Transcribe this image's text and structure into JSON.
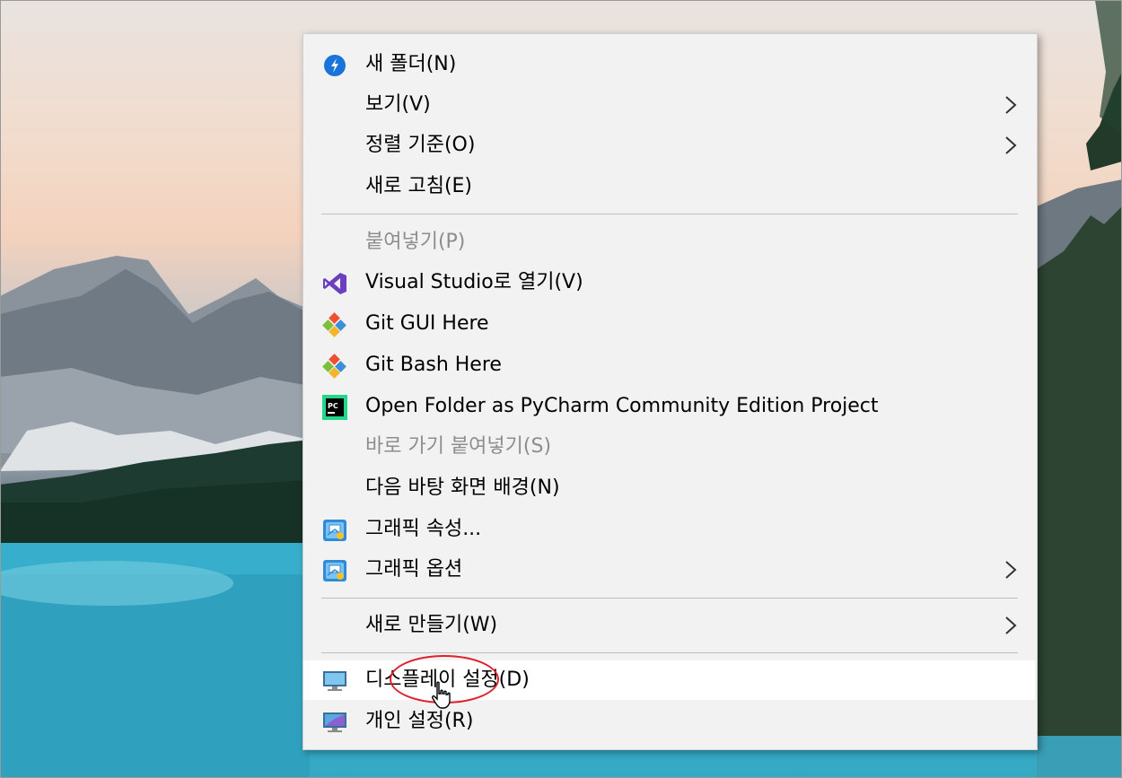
{
  "context_menu": {
    "items": [
      {
        "label": "새 폴더(N)",
        "icon": "new-folder-quick-icon",
        "submenu": false,
        "disabled": false
      },
      {
        "label": "보기(V)",
        "icon": "",
        "submenu": true,
        "disabled": false
      },
      {
        "label": "정렬 기준(O)",
        "icon": "",
        "submenu": true,
        "disabled": false
      },
      {
        "label": "새로 고침(E)",
        "icon": "",
        "submenu": false,
        "disabled": false
      },
      {
        "label": "붙여넣기(P)",
        "icon": "",
        "submenu": false,
        "disabled": true
      },
      {
        "label": "Visual Studio로 열기(V)",
        "icon": "visual-studio-icon",
        "submenu": false,
        "disabled": false
      },
      {
        "label": "Git GUI Here",
        "icon": "git-icon",
        "submenu": false,
        "disabled": false
      },
      {
        "label": "Git Bash Here",
        "icon": "git-icon",
        "submenu": false,
        "disabled": false
      },
      {
        "label": "Open Folder as PyCharm Community Edition Project",
        "icon": "pycharm-icon",
        "submenu": false,
        "disabled": false
      },
      {
        "label": "바로 가기 붙여넣기(S)",
        "icon": "",
        "submenu": false,
        "disabled": true
      },
      {
        "label": "다음 바탕 화면 배경(N)",
        "icon": "",
        "submenu": false,
        "disabled": false
      },
      {
        "label": "그래픽 속성...",
        "icon": "intel-graphics-icon",
        "submenu": false,
        "disabled": false
      },
      {
        "label": "그래픽 옵션",
        "icon": "intel-graphics-icon",
        "submenu": true,
        "disabled": false
      },
      {
        "label": "새로 만들기(W)",
        "icon": "",
        "submenu": true,
        "disabled": false
      },
      {
        "label": "디스플레이 설정(D)",
        "icon": "display-settings-icon",
        "submenu": false,
        "disabled": false,
        "highlighted": true
      },
      {
        "label": "개인 설정(R)",
        "icon": "personalize-icon",
        "submenu": false,
        "disabled": false
      }
    ]
  },
  "colors": {
    "menu_bg": "#f2f2f2",
    "hover_bg": "#ffffff",
    "disabled_text": "#8d8d8d",
    "annotation": "#e0202a"
  }
}
